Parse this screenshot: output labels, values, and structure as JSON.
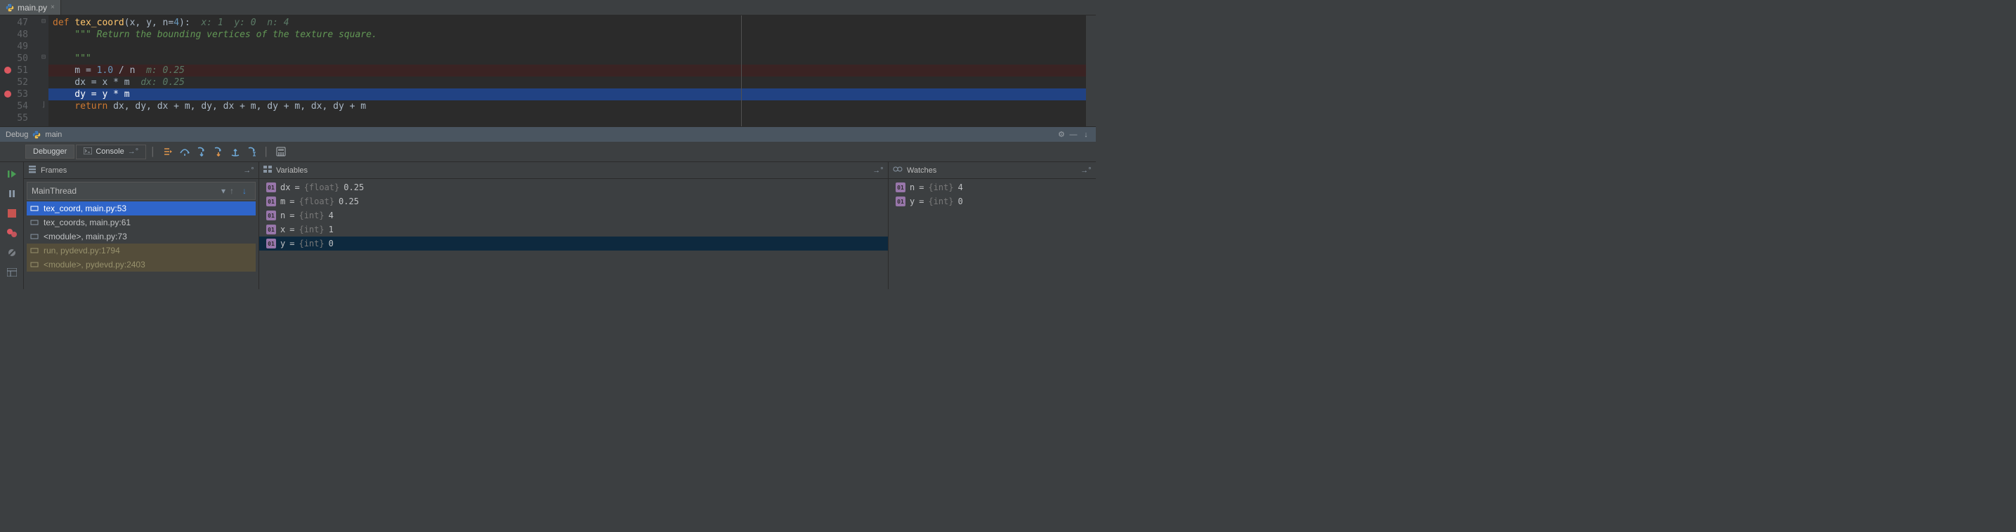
{
  "tab": {
    "filename": "main.py"
  },
  "editor": {
    "lines": [
      {
        "num": "47"
      },
      {
        "num": "48"
      },
      {
        "num": "49"
      },
      {
        "num": "50"
      },
      {
        "num": "51"
      },
      {
        "num": "52"
      },
      {
        "num": "53"
      },
      {
        "num": "54"
      },
      {
        "num": "55"
      }
    ],
    "l47_def": "def ",
    "l47_fn": "tex_coord",
    "l47_sig": "(x, y, n=",
    "l47_default": "4",
    "l47_close": "):  ",
    "l47_hint": "x: 1  y: 0  n: 4",
    "l48_doc": "    \"\"\" Return the bounding vertices of the texture square.",
    "l49_blank": " ",
    "l50_doc": "    \"\"\"",
    "l51_code": "    m = ",
    "l51_num": "1.0",
    "l51_rest": " / n  ",
    "l51_hint": "m: 0.25",
    "l52_code": "    dx = x * m  ",
    "l52_hint": "dx: 0.25",
    "l53_code": "    dy = y * m",
    "l54_ret": "    return ",
    "l54_rest": "dx, dy, dx + m, dy, dx + m, dy + m, dx, dy + m"
  },
  "debug": {
    "header_label": "Debug",
    "config_name": "main",
    "tab_debugger": "Debugger",
    "tab_console": "Console",
    "frames_title": "Frames",
    "vars_title": "Variables",
    "watches_title": "Watches",
    "thread_name": "MainThread",
    "frames": [
      {
        "label": "tex_coord, main.py:53",
        "selected": true,
        "lib": false
      },
      {
        "label": "tex_coords, main.py:61",
        "selected": false,
        "lib": false
      },
      {
        "label": "<module>, main.py:73",
        "selected": false,
        "lib": false
      },
      {
        "label": "run, pydevd.py:1794",
        "selected": false,
        "lib": true
      },
      {
        "label": "<module>, pydevd.py:2403",
        "selected": false,
        "lib": true
      }
    ],
    "variables": [
      {
        "name": "dx",
        "type": "{float}",
        "value": "0.25",
        "selected": false
      },
      {
        "name": "m",
        "type": "{float}",
        "value": "0.25",
        "selected": false
      },
      {
        "name": "n",
        "type": "{int}",
        "value": "4",
        "selected": false
      },
      {
        "name": "x",
        "type": "{int}",
        "value": "1",
        "selected": false
      },
      {
        "name": "y",
        "type": "{int}",
        "value": "0",
        "selected": true
      }
    ],
    "watches": [
      {
        "name": "n",
        "type": "{int}",
        "value": "4"
      },
      {
        "name": "y",
        "type": "{int}",
        "value": "0"
      }
    ]
  },
  "icons": {
    "badge_sym": "01"
  }
}
